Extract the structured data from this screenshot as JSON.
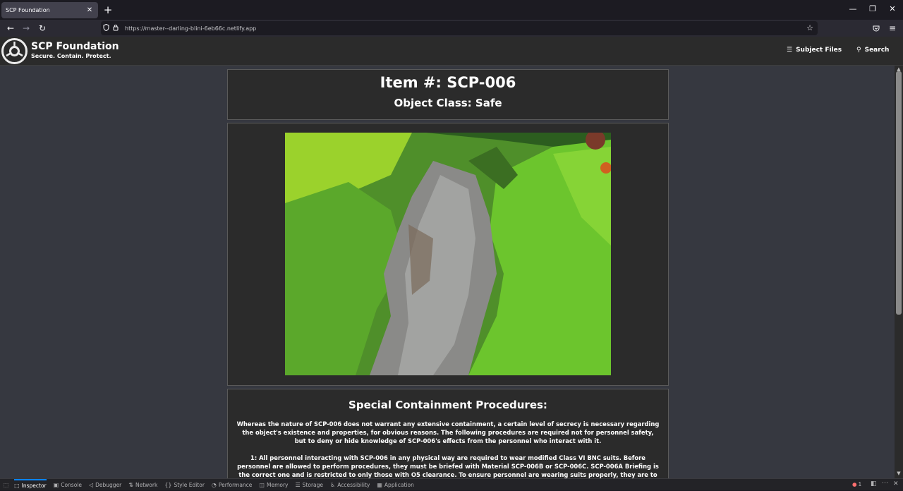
{
  "browser": {
    "tab_title": "SCP Foundation",
    "tab_close": "✕",
    "new_tab": "+",
    "url": "https://master--darling-blini-6eb66c.netlify.app",
    "window_controls": [
      "—",
      "❐",
      "✕"
    ],
    "nav_icons": [
      "←",
      "→",
      "↻"
    ]
  },
  "site": {
    "name": "SCP Foundation",
    "tagline": "Secure. Contain. Protect.",
    "nav": [
      {
        "icon": "☰",
        "label": "Subject Files"
      },
      {
        "icon": "⚲",
        "label": "Search"
      }
    ]
  },
  "article": {
    "item_number": "Item #: SCP-006",
    "object_class": "Object Class: Safe",
    "procedures_heading": "Special Containment Procedures:",
    "procedures_p1": "Whereas the nature of SCP-006 does not warrant any extensive containment, a certain level of secrecy is necessary regarding the object's existence and properties, for obvious reasons. The following procedures are required not for personnel safety, but to deny or hide knowledge of SCP-006's effects from the personnel who interact with it.",
    "procedures_p2": "1: All personnel interacting with SCP-006 in any physical way are required to wear modified Class VI BNC suits. Before personnel are allowed to perform procedures, they must be briefed with Material SCP-006B or SCP-006C. SCP-006A Briefing is the correct one and is restricted to only those with O5 clearance. To ensure personnel are wearing suits properly, they are to be submerged into a pool of"
  },
  "devtools": {
    "tabs": [
      {
        "icon": "⬚",
        "label": "Inspector"
      },
      {
        "icon": "▣",
        "label": "Console"
      },
      {
        "icon": "◁",
        "label": "Debugger"
      },
      {
        "icon": "⇅",
        "label": "Network"
      },
      {
        "icon": "{}",
        "label": "Style Editor"
      },
      {
        "icon": "◔",
        "label": "Performance"
      },
      {
        "icon": "◫",
        "label": "Memory"
      },
      {
        "icon": "☰",
        "label": "Storage"
      },
      {
        "icon": "♿",
        "label": "Accessibility"
      },
      {
        "icon": "▦",
        "label": "Application"
      }
    ],
    "error_count": "1"
  }
}
